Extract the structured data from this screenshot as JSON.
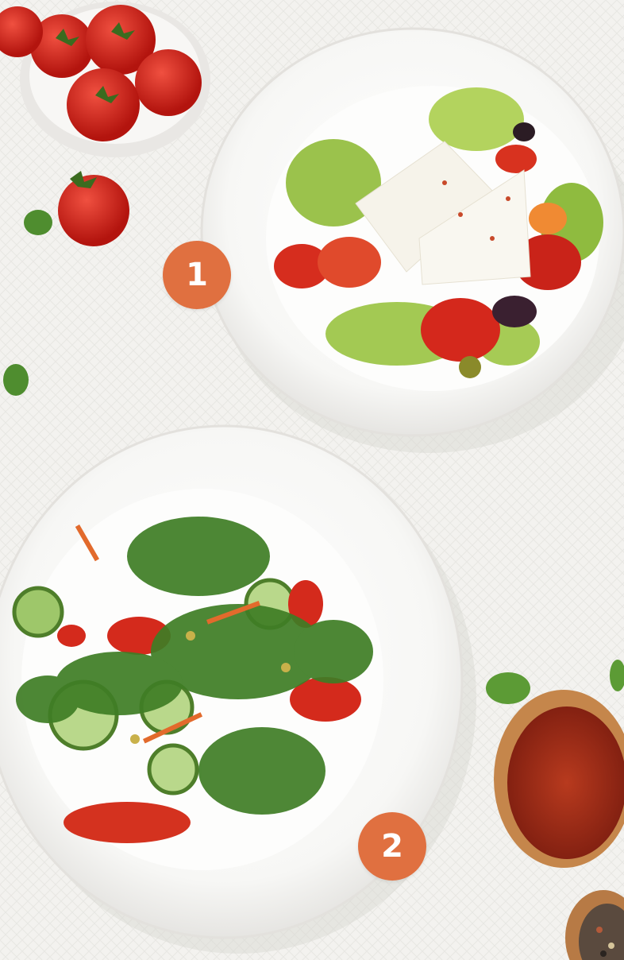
{
  "markers": [
    {
      "label": "1"
    },
    {
      "label": "2"
    }
  ],
  "colors": {
    "marker_fill": "#e07040",
    "marker_text": "#ffffff",
    "tablecloth": "#f3f2ef",
    "plate": "#fbfbfa"
  }
}
